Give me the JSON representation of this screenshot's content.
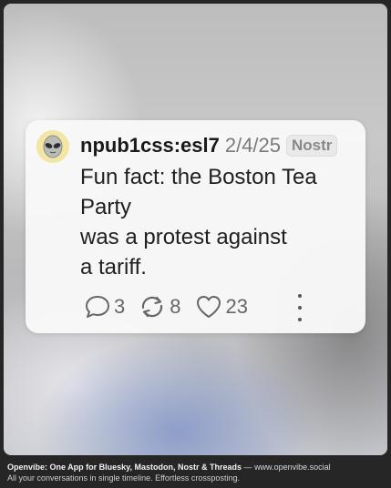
{
  "post": {
    "avatar_icon": "alien-face-icon",
    "handle": "npub1css:esl7",
    "date": "2/4/25",
    "network": "Nostr",
    "text_lines": [
      "Fun fact: the Boston Tea",
      "Party",
      "was a protest against",
      "a tariff."
    ],
    "actions": {
      "replies": "3",
      "reposts": "8",
      "likes": "23"
    }
  },
  "footer": {
    "brand": "Openvibe: One App for Bluesky, Mastodon, Nostr & Threads",
    "separator": " — ",
    "site": "www.openvibe.social",
    "tagline": "All your conversations in single timeline. Effortless crossposting."
  },
  "colors": {
    "avatar_bg": "#f3e6a4",
    "card_bg": "#f8f8f8",
    "text": "#1f1f1f",
    "muted": "#7a7a7a"
  }
}
